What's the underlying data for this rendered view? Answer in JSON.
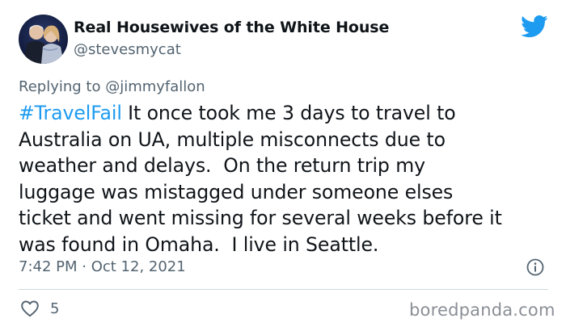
{
  "tweet": {
    "display_name": "Real Housewives of the White House",
    "handle": "@stevesmycat",
    "replying_prefix": "Replying to ",
    "replying_to": "@jimmyfallon",
    "hashtag": "#TravelFail",
    "body": " It once took me 3 days to travel to\nAustralia on UA, multiple misconnects due to\nweather and delays.  On the return trip my\nluggage was mistagged under someone elses\nticket and went missing for several weeks before it\nwas found in Omaha.  I live in Seattle.",
    "timestamp": "7:42 PM · Oct 12, 2021",
    "like_count": "5"
  },
  "icons": {
    "brand": "twitter-bird-icon",
    "info": "info-icon",
    "like": "heart-icon"
  },
  "colors": {
    "accent": "#1d9bf0",
    "text": "#0f1419",
    "secondary": "#536471",
    "divider": "#cfd9de"
  },
  "watermark": "boredpanda.com"
}
